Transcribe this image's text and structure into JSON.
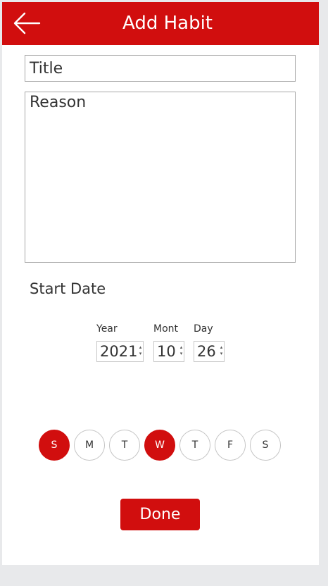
{
  "header": {
    "title": "Add Habit",
    "back_icon": "arrow-left-icon"
  },
  "form": {
    "title_placeholder": "Title",
    "title_value": "",
    "reason_placeholder": "Reason",
    "reason_value": ""
  },
  "start_date": {
    "label": "Start Date",
    "year_label": "Year",
    "year_value": "2021",
    "month_label": "Mont",
    "month_value": "10",
    "day_label": "Day",
    "day_value": "26"
  },
  "weekdays": [
    {
      "label": "S",
      "selected": true
    },
    {
      "label": "M",
      "selected": false
    },
    {
      "label": "T",
      "selected": false
    },
    {
      "label": "W",
      "selected": true
    },
    {
      "label": "T",
      "selected": false
    },
    {
      "label": "F",
      "selected": false
    },
    {
      "label": "S",
      "selected": false
    }
  ],
  "actions": {
    "done_label": "Done"
  },
  "colors": {
    "accent": "#d10e0e",
    "background": "#e8e9eb",
    "surface": "#ffffff"
  }
}
